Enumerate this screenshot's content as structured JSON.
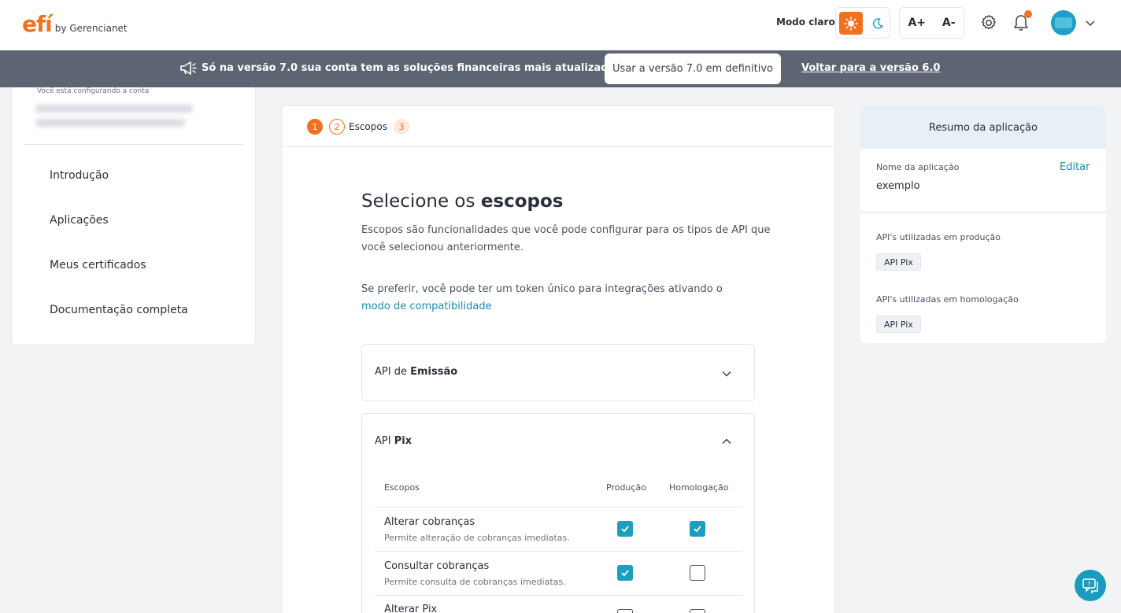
{
  "header": {
    "logo_mark": "efí",
    "logo_by": "by Gerencianet",
    "mode_label": "Modo claro",
    "font_increase": "A+",
    "font_decrease": "A-"
  },
  "banner": {
    "message": "Só na versão 7.0 sua conta tem as soluções financeiras mais atualizadas",
    "button": "Usar a versão 7.0 em definitivo",
    "link": "Voltar para a versão 6.0"
  },
  "sidebar": {
    "note": "Você está configurando a conta",
    "items": [
      {
        "label": "Introdução"
      },
      {
        "label": "Aplicações"
      },
      {
        "label": "Meus certificados"
      },
      {
        "label": "Documentação completa"
      }
    ]
  },
  "stepper": {
    "step1": "1",
    "step2": "2",
    "step2_label": "Escopos",
    "step3": "3"
  },
  "main": {
    "title_prefix": "Selecione os ",
    "title_bold": "escopos",
    "description": "Escopos são funcionalidades que você pode configurar para os tipos de API que você selecionou anteriormente.",
    "compat_text": "Se preferir, você pode ter um token único para integrações ativando o",
    "compat_link": "modo de compatibilidade"
  },
  "accordions": [
    {
      "prefix": "API de ",
      "bold": "Emissão",
      "expanded": false
    },
    {
      "prefix": "API ",
      "bold": "Pix",
      "expanded": true
    }
  ],
  "scopes_table": {
    "headers": {
      "scope": "Escopos",
      "production": "Produção",
      "homologation": "Homologação"
    },
    "rows": [
      {
        "name": "Alterar cobranças",
        "desc": "Permite alteração de cobranças imediatas.",
        "production": true,
        "homologation": true
      },
      {
        "name": "Consultar cobranças",
        "desc": "Permite consulta de cobranças imediatas.",
        "production": true,
        "homologation": false
      },
      {
        "name": "Alterar Pix",
        "desc": "",
        "production": false,
        "homologation": false
      }
    ]
  },
  "summary": {
    "title": "Resumo da aplicação",
    "app_name_label": "Nome da aplicação",
    "app_name_value": "exemplo",
    "edit": "Editar",
    "prod_label": "API's utilizadas em produção",
    "prod_tag": "API Pix",
    "homolog_label": "API's utilizadas em homologação",
    "homolog_tag": "API Pix"
  },
  "colors": {
    "brand_orange": "#f37021",
    "accent_teal": "#1d9ec1",
    "banner_bg": "#5d6472"
  }
}
